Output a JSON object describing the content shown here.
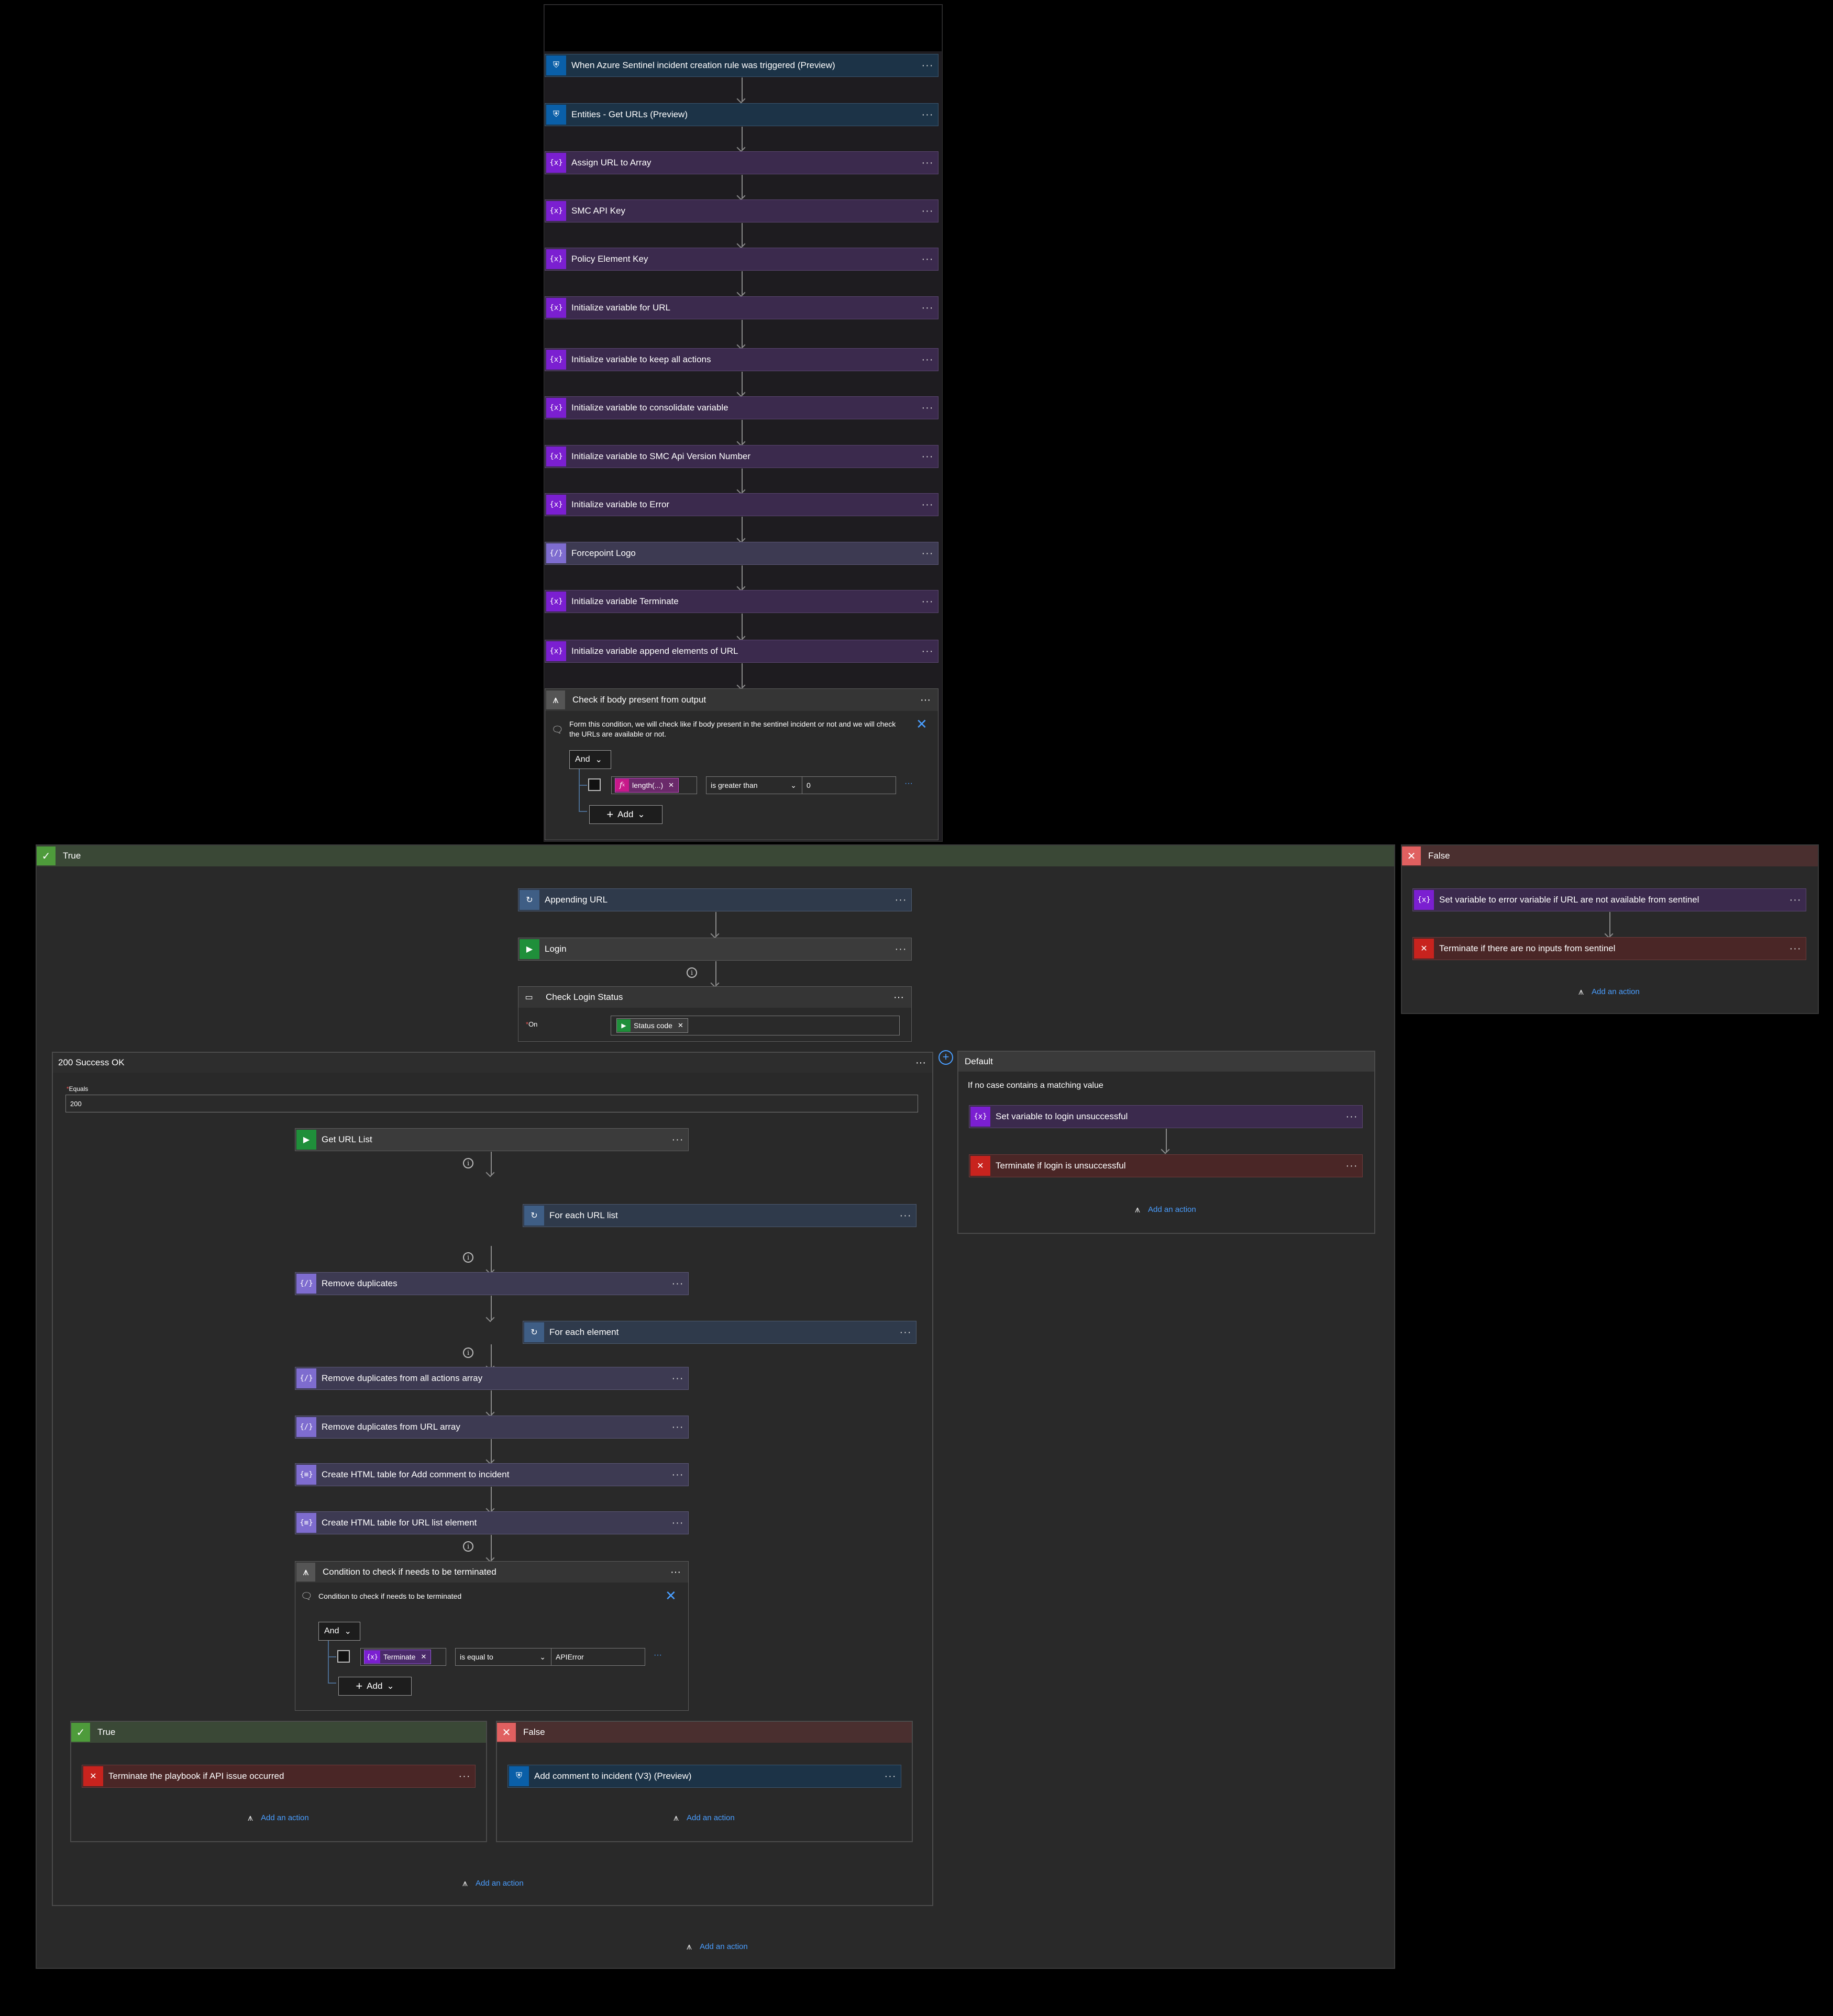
{
  "trigger": {
    "label": "When Azure Sentinel incident creation rule was triggered (Preview)"
  },
  "steps": [
    {
      "label": "Entities - Get URLs (Preview)"
    },
    {
      "label": "Assign URL to Array"
    },
    {
      "label": "SMC API Key"
    },
    {
      "label": "Policy Element Key"
    },
    {
      "label": "Initialize variable for URL"
    },
    {
      "label": "Initialize variable to keep all actions"
    },
    {
      "label": "Initialize variable to consolidate variable"
    },
    {
      "label": "Initialize variable to SMC Api Version Number"
    },
    {
      "label": "Initialize variable to Error"
    },
    {
      "label": "Forcepoint Logo"
    },
    {
      "label": "Initialize variable Terminate"
    },
    {
      "label": "Initialize variable append elements of URL"
    }
  ],
  "condition1": {
    "title": "Check if body present from output",
    "comment": "Form this condition, we will check like if body present in the sentinel incident or not and we will check the URLs are available or not.",
    "and_label": "And",
    "token_label": "length(...)",
    "operator": "is greater than",
    "value": "0",
    "add_label": "Add"
  },
  "true_branch": {
    "title": "True",
    "appending_url": "Appending URL",
    "login": "Login",
    "check_login_status": "Check Login Status",
    "on_label": "On",
    "status_code_token": "Status code",
    "add_action": "Add an action"
  },
  "false_branch": {
    "title": "False",
    "set_error": "Set variable to error variable if URL are not available from sentinel",
    "terminate": "Terminate if there are no inputs from sentinel",
    "add_action": "Add an action"
  },
  "case200": {
    "title": "200 Success OK",
    "equals_label": "Equals",
    "equals_value": "200",
    "get_url_list": "Get URL List",
    "for_each_url": "For each URL list",
    "remove_duplicates": "Remove duplicates",
    "for_each_element": "For each element",
    "remove_dup_actions": "Remove duplicates from all actions array",
    "remove_dup_url": "Remove duplicates from URL array",
    "html_table_comment": "Create HTML table for Add comment to incident",
    "html_table_url": "Create HTML table for URL list element",
    "cond2_title": "Condition to check if needs to be terminated",
    "cond2_comment": "Condition to check if needs to be terminated",
    "and_label": "And",
    "token_label": "Terminate",
    "operator": "is equal to",
    "value": "APIError",
    "add_label": "Add",
    "add_action": "Add an action"
  },
  "inner_true": {
    "title": "True",
    "terminate": "Terminate the playbook if API issue occurred",
    "add_action": "Add an action"
  },
  "inner_false": {
    "title": "False",
    "add_comment": "Add comment to incident (V3) (Preview)",
    "add_action": "Add an action"
  },
  "default_case": {
    "title": "Default",
    "note": "If no case contains a matching value",
    "set_var": "Set variable to login unsuccessful",
    "terminate": "Terminate if login is unsuccessful",
    "add_action": "Add an action"
  },
  "colors": {
    "sentinel": "#0a5fa8",
    "variable": "#7b1fd1",
    "terminate": "#c8231e",
    "true_header": "#3c4a37",
    "false_header": "#4a2f2f",
    "link": "#4a9eff"
  }
}
